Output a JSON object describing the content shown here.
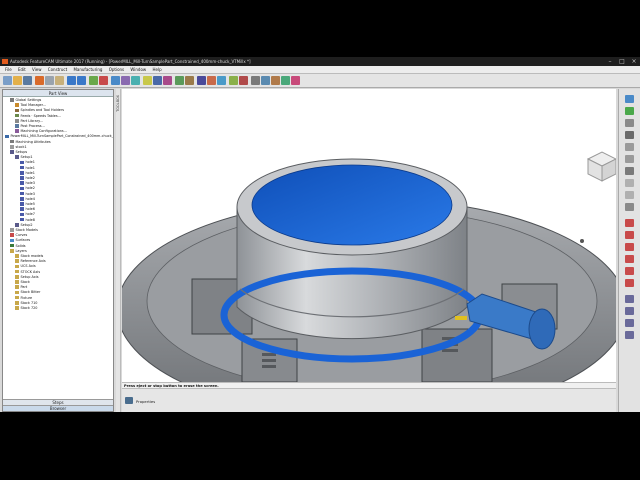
{
  "window": {
    "title": "Autodesk FeatureCAM Ultimate 2017 (Running) - [PowerMILL_Mill-TurnSamplePart_Constrained_400mm-chuck_VTMillx *]"
  },
  "menu": [
    "File",
    "Edit",
    "View",
    "Construct",
    "Manufacturing",
    "Options",
    "Window",
    "Help"
  ],
  "panel": {
    "title": "Part View",
    "side_label": "TOOLBOX",
    "tabs": [
      "Steps",
      "Browser"
    ],
    "tree": [
      {
        "label": "Global Settings",
        "indent": 1,
        "color": "#7a7a7a"
      },
      {
        "label": "Tool Manager...",
        "indent": 2,
        "color": "#c98a2a"
      },
      {
        "label": "Spindles and Tool Holders",
        "indent": 2,
        "color": "#8a6a3a"
      },
      {
        "label": "Feeds · Speeds Tables...",
        "indent": 2,
        "color": "#6a8a4a"
      },
      {
        "label": "Part Library...",
        "indent": 2,
        "color": "#8a8a8a"
      },
      {
        "label": "Post Process...",
        "indent": 2,
        "color": "#5a7aa0"
      },
      {
        "label": "Machining Configurations...",
        "indent": 2,
        "color": "#8a5a9a"
      },
      {
        "label": "PowerMILL_Mill-TurnSamplePart_Constrained_400mm-chuck_V",
        "indent": 0,
        "color": "#3a6aa8"
      },
      {
        "label": "Machining Attributes",
        "indent": 1,
        "color": "#7a7a7a"
      },
      {
        "label": "stock1",
        "indent": 1,
        "color": "#9a9a9a"
      },
      {
        "label": "Setups",
        "indent": 1,
        "color": "#5a5a8a"
      },
      {
        "label": "Setup1",
        "indent": 2,
        "color": "#5a5a8a"
      },
      {
        "label": "hole1",
        "indent": 3,
        "color": "#4a5aa8"
      },
      {
        "label": "hole1",
        "indent": 3,
        "color": "#4a5aa8"
      },
      {
        "label": "hole1",
        "indent": 3,
        "color": "#4a5aa8"
      },
      {
        "label": "hole2",
        "indent": 3,
        "color": "#4a5aa8"
      },
      {
        "label": "hole3",
        "indent": 3,
        "color": "#4a5aa8"
      },
      {
        "label": "hole2",
        "indent": 3,
        "color": "#4a5aa8"
      },
      {
        "label": "hole3",
        "indent": 3,
        "color": "#4a5aa8"
      },
      {
        "label": "hole4",
        "indent": 3,
        "color": "#4a5aa8"
      },
      {
        "label": "hole5",
        "indent": 3,
        "color": "#4a5aa8"
      },
      {
        "label": "hole6",
        "indent": 3,
        "color": "#4a5aa8"
      },
      {
        "label": "hole7",
        "indent": 3,
        "color": "#4a5aa8"
      },
      {
        "label": "hole8",
        "indent": 3,
        "color": "#4a5aa8"
      },
      {
        "label": "Setup2",
        "indent": 2,
        "color": "#5a5a8a"
      },
      {
        "label": "Stock Models",
        "indent": 1,
        "color": "#9a9a9a"
      },
      {
        "label": "Curves",
        "indent": 1,
        "color": "#c84a4a"
      },
      {
        "label": "Surfaces",
        "indent": 1,
        "color": "#4a8ac8"
      },
      {
        "label": "Solids",
        "indent": 1,
        "color": "#3a7a3a"
      },
      {
        "label": "Layers",
        "indent": 1,
        "color": "#c8a84a"
      },
      {
        "label": "Stock models",
        "indent": 2,
        "color": "#c8a84a"
      },
      {
        "label": "Reference Axis",
        "indent": 2,
        "color": "#c8a84a"
      },
      {
        "label": "UCS Axis",
        "indent": 2,
        "color": "#c8a84a"
      },
      {
        "label": "STOCK Axis",
        "indent": 2,
        "color": "#c8a84a"
      },
      {
        "label": "Setup Axis",
        "indent": 2,
        "color": "#c8a84a"
      },
      {
        "label": "Stock",
        "indent": 2,
        "color": "#c8a84a"
      },
      {
        "label": "Part",
        "indent": 2,
        "color": "#c8a84a"
      },
      {
        "label": "Stock Bitter",
        "indent": 2,
        "color": "#c8a84a"
      },
      {
        "label": "Fixture",
        "indent": 2,
        "color": "#c8a84a"
      },
      {
        "label": "Stock 710",
        "indent": 2,
        "color": "#c8a84a"
      },
      {
        "label": "Stock 720",
        "indent": 2,
        "color": "#c8a84a"
      }
    ]
  },
  "status": {
    "message": "Press eject or stop button to erase the screen."
  },
  "properties": {
    "label": "Properties"
  },
  "colors": {
    "part_blue": "#1a63d6",
    "steel": "#b9bcc0",
    "chuck_dark": "#6d7074",
    "probe_blue": "#3a7ac8"
  }
}
